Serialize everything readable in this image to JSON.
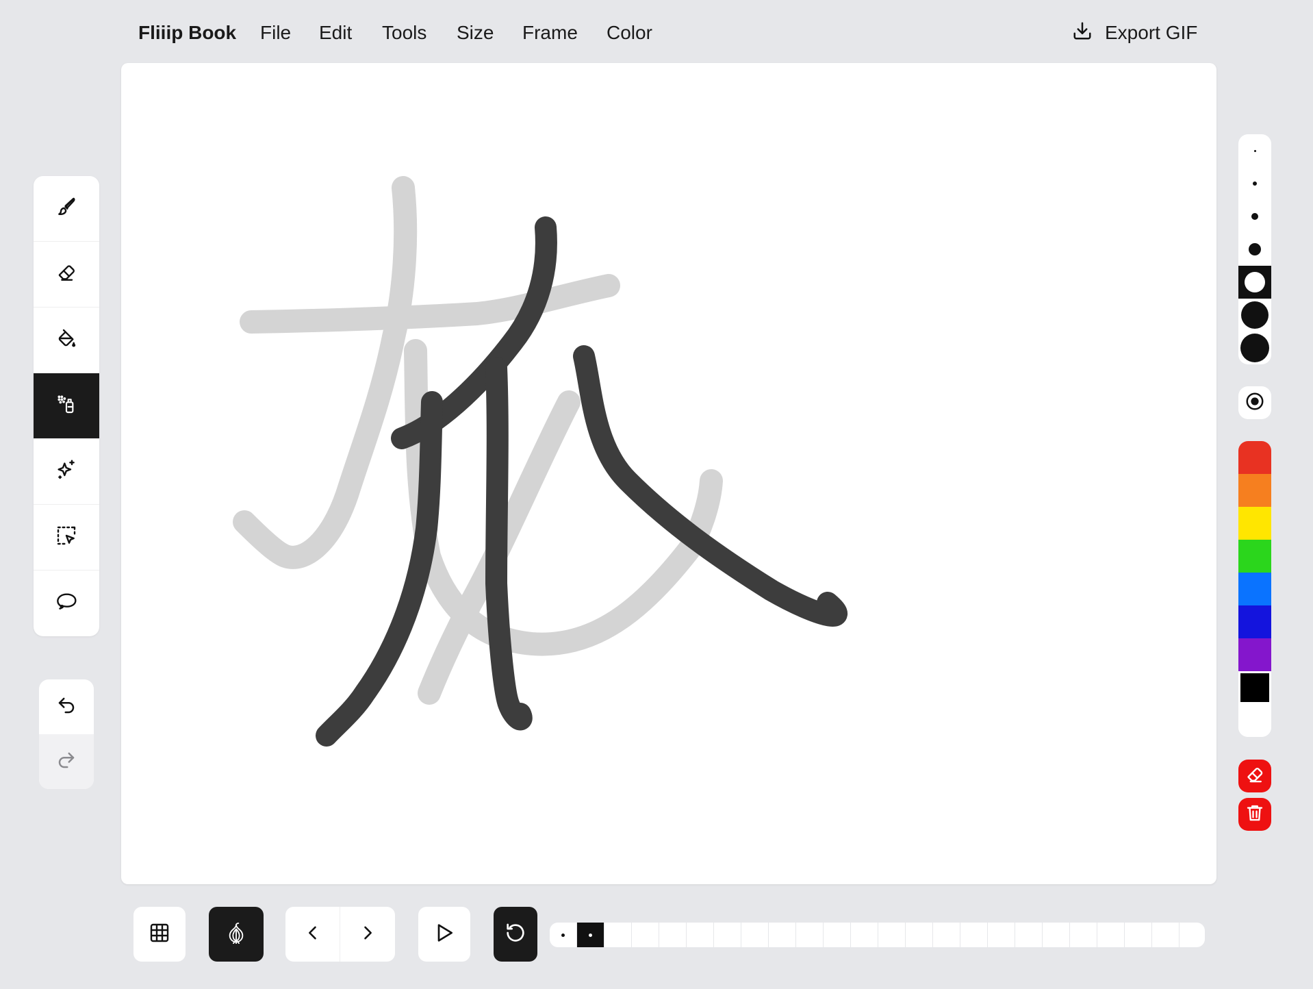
{
  "menubar": {
    "app_name": "Fliiip Book",
    "items": [
      "File",
      "Edit",
      "Tools",
      "Size",
      "Frame",
      "Color"
    ],
    "export_label": "Export GIF",
    "export_icon": "download-icon"
  },
  "tools": [
    {
      "name": "brush",
      "icon": "brush-icon",
      "active": false
    },
    {
      "name": "eraser",
      "icon": "eraser-icon",
      "active": false
    },
    {
      "name": "fill",
      "icon": "paint-bucket-icon",
      "active": false
    },
    {
      "name": "spray",
      "icon": "spray-can-icon",
      "active": true
    },
    {
      "name": "sparkle",
      "icon": "sparkles-icon",
      "active": false
    },
    {
      "name": "select",
      "icon": "selection-icon",
      "active": false
    },
    {
      "name": "lasso",
      "icon": "lasso-icon",
      "active": false
    }
  ],
  "history": {
    "undo_icon": "undo-icon",
    "redo_icon": "redo-icon",
    "redo_enabled": false
  },
  "brush_sizes": {
    "options": [
      1,
      2,
      3,
      4,
      5,
      6,
      7
    ],
    "selected_index": 4
  },
  "opacity_icon": "target-icon",
  "colors": {
    "swatches": [
      "#e83222",
      "#f67f1f",
      "#ffe600",
      "#2bd61c",
      "#0a73ff",
      "#1414dd",
      "#8416cc",
      "#000000",
      "#ffffff"
    ],
    "selected": "#000000"
  },
  "actions": {
    "clear_icon": "eraser-clear-icon",
    "delete_icon": "trash-icon",
    "color": "#ee1111"
  },
  "bottom_bar": {
    "grid_icon": "grid-icon",
    "onion_icon": "onion-skin-icon",
    "onion_active": true,
    "prev_icon": "chevron-left-icon",
    "next_icon": "chevron-right-icon",
    "play_icon": "play-icon",
    "loop_icon": "loop-icon",
    "loop_active": true
  },
  "timeline": {
    "frame_count": 24,
    "filled_frames": [
      1,
      2
    ],
    "current_frame": 2
  }
}
